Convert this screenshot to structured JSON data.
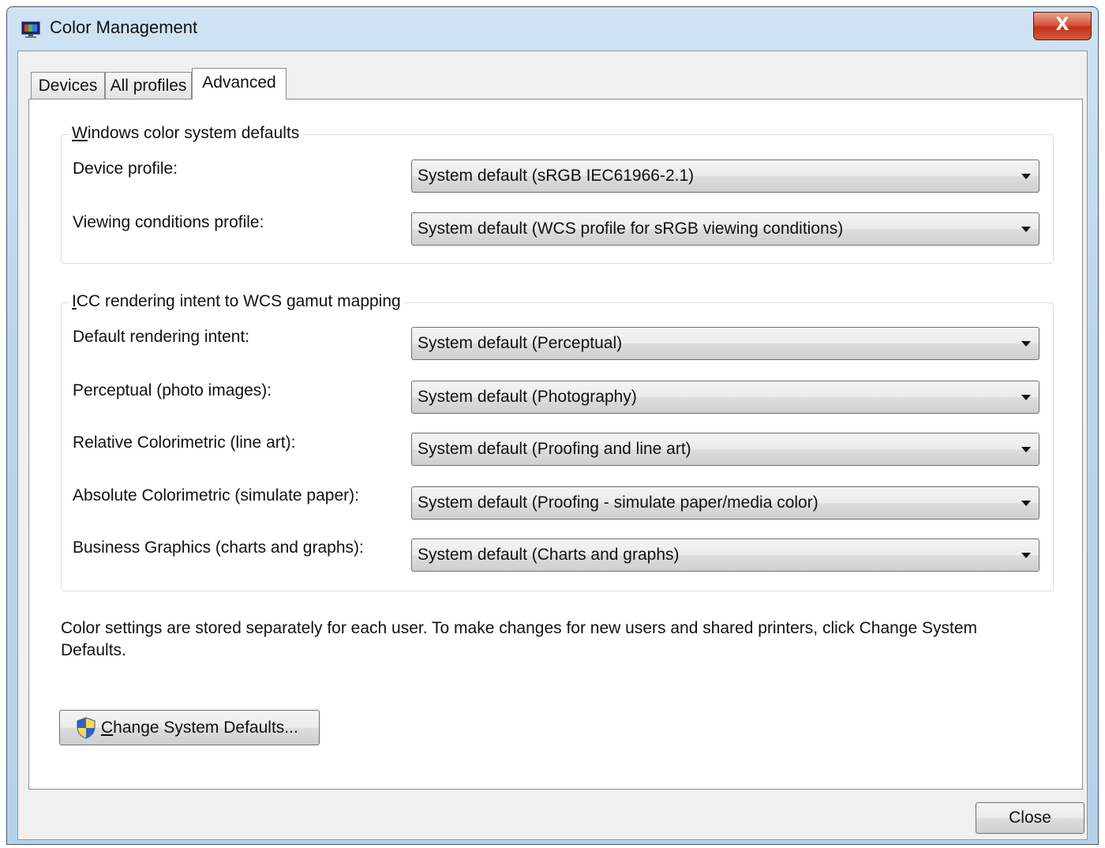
{
  "window": {
    "title": "Color Management",
    "close_glyph": "X",
    "icon": "monitor-color-icon"
  },
  "tabs": [
    {
      "label": "Devices",
      "active": false
    },
    {
      "label": "All profiles",
      "active": false
    },
    {
      "label": "Advanced",
      "active": true
    }
  ],
  "wcs_defaults": {
    "title_mnemonic": "W",
    "title_rest": "indows  color system defaults",
    "rows": [
      {
        "label": "Device profile:",
        "value": "System default (sRGB IEC61966-2.1)"
      },
      {
        "label": "Viewing conditions profile:",
        "value": "System default (WCS profile for sRGB viewing conditions)"
      }
    ]
  },
  "icc_mapping": {
    "title_mnemonic": "I",
    "title_rest": "CC  rendering intent to WCS gamut mapping",
    "rows": [
      {
        "label": "Default rendering intent:",
        "value": "System default (Perceptual)"
      },
      {
        "label": "Perceptual (photo images):",
        "value": "System default (Photography)"
      },
      {
        "label": "Relative Colorimetric (line art):",
        "value": "System default (Proofing and line art)"
      },
      {
        "label": "Absolute Colorimetric (simulate paper):",
        "value": "System default (Proofing - simulate paper/media color)"
      },
      {
        "label": "Business Graphics (charts and graphs):",
        "value": "System default (Charts and graphs)"
      }
    ]
  },
  "note": "Color settings are stored separately for each user. To make changes for new users and shared printers, click Change System Defaults.",
  "change_defaults_button": {
    "mnemonic": "C",
    "rest": "hange System Defaults...",
    "icon": "uac-shield-icon"
  },
  "close_button": {
    "label": "Close"
  },
  "colors": {
    "title_bar": "#bcd6ec",
    "close_button": "#c0331a",
    "client_bg": "#f0f0f0",
    "panel_bg": "#ffffff"
  }
}
